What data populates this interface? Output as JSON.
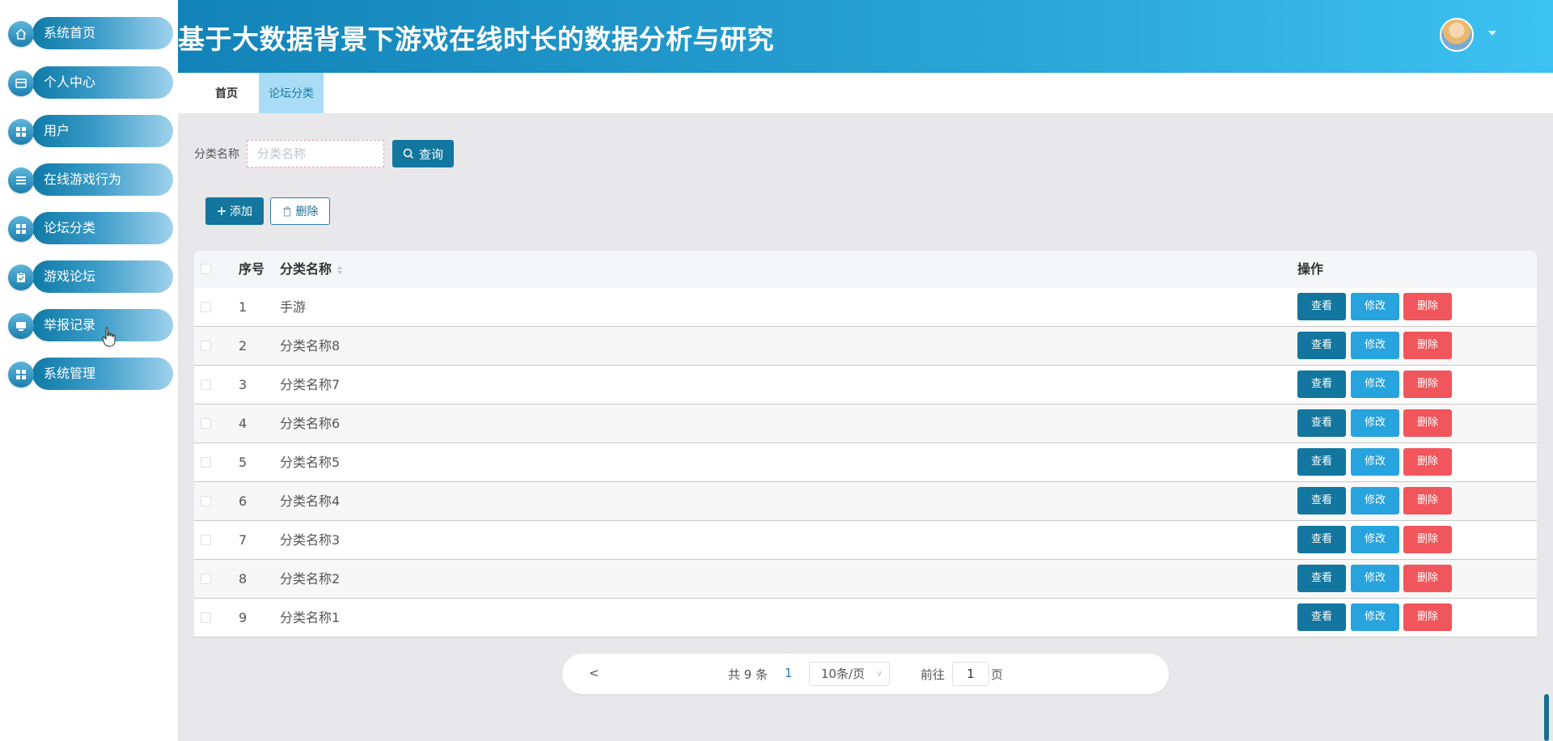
{
  "header": {
    "title": "基于大数据背景下游戏在线时长的数据分析与研究"
  },
  "sidebar": {
    "items": [
      {
        "label": "系统首页",
        "icon": "home-icon"
      },
      {
        "label": "个人中心",
        "icon": "card-icon"
      },
      {
        "label": "用户",
        "icon": "grid-icon"
      },
      {
        "label": "在线游戏行为",
        "icon": "list-icon"
      },
      {
        "label": "论坛分类",
        "icon": "grid-icon"
      },
      {
        "label": "游戏论坛",
        "icon": "clipboard-icon"
      },
      {
        "label": "举报记录",
        "icon": "monitor-icon"
      },
      {
        "label": "系统管理",
        "icon": "grid-icon"
      }
    ]
  },
  "tabs": [
    {
      "label": "首页",
      "active": false
    },
    {
      "label": "论坛分类",
      "active": true
    }
  ],
  "filter": {
    "label": "分类名称",
    "placeholder": "分类名称",
    "value": "",
    "search_label": "查询"
  },
  "toolbar": {
    "add_label": "添加",
    "delete_label": "删除"
  },
  "table": {
    "headers": {
      "index": "序号",
      "name": "分类名称",
      "actions": "操作"
    },
    "rows": [
      {
        "index": "1",
        "name": "手游"
      },
      {
        "index": "2",
        "name": "分类名称8"
      },
      {
        "index": "3",
        "name": "分类名称7"
      },
      {
        "index": "4",
        "name": "分类名称6"
      },
      {
        "index": "5",
        "name": "分类名称5"
      },
      {
        "index": "6",
        "name": "分类名称4"
      },
      {
        "index": "7",
        "name": "分类名称3"
      },
      {
        "index": "8",
        "name": "分类名称2"
      },
      {
        "index": "9",
        "name": "分类名称1"
      }
    ],
    "action_labels": {
      "view": "查看",
      "edit": "修改",
      "delete": "删除"
    }
  },
  "pager": {
    "prev": "<",
    "total": "共 9 条",
    "current": "1",
    "page_size": "10条/页",
    "goto_label": "前往",
    "goto_value": "1",
    "page_suffix": "页"
  },
  "colors": {
    "primary": "#12769e",
    "edit": "#27a3de",
    "danger": "#f0565b",
    "header_start": "#1283b8",
    "header_end": "#3cc2f2"
  }
}
